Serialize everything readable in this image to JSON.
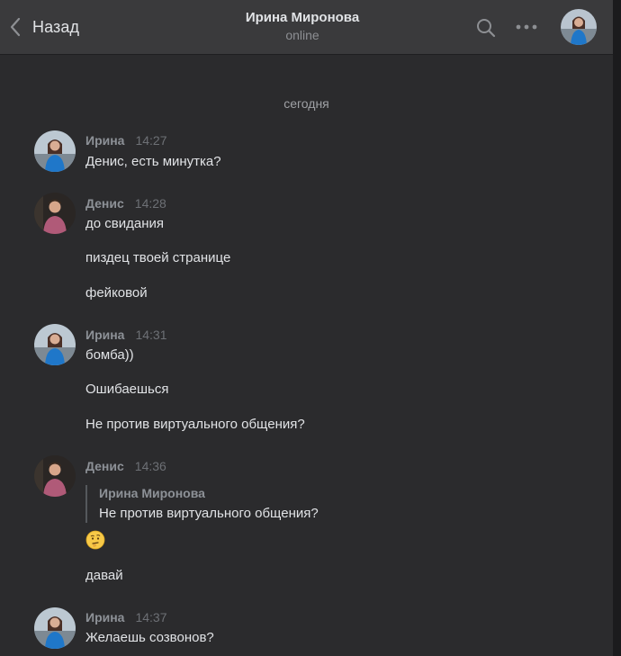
{
  "header": {
    "back_label": "Назад",
    "contact_name": "Ирина Миронова",
    "status": "online"
  },
  "date_separator": "сегодня",
  "messages": [
    {
      "author": "Ирина",
      "time": "14:27",
      "lines": [
        "Денис, есть минутка?"
      ]
    },
    {
      "author": "Денис",
      "time": "14:28",
      "lines": [
        "до свидания",
        "пиздец твоей странице",
        "фейковой"
      ]
    },
    {
      "author": "Ирина",
      "time": "14:31",
      "lines": [
        "бомба))",
        "Ошибаешься",
        "Не против виртуального общения?"
      ]
    },
    {
      "author": "Денис",
      "time": "14:36",
      "reply": {
        "author": "Ирина Миронова",
        "text": "Не против виртуального общения?"
      },
      "emoji": "thinking-face",
      "lines": [
        "давай"
      ]
    },
    {
      "author": "Ирина",
      "time": "14:37",
      "lines": [
        "Желаешь созвонов?"
      ]
    }
  ],
  "colors": {
    "background": "#2b2b2d",
    "header": "#3a3a3c",
    "author": "#8d9197",
    "time": "#6d7075",
    "text": "#e1e3e6"
  },
  "icons": [
    "chevron-left-icon",
    "search-icon",
    "more-icon",
    "avatar",
    "thinking-emoji"
  ]
}
